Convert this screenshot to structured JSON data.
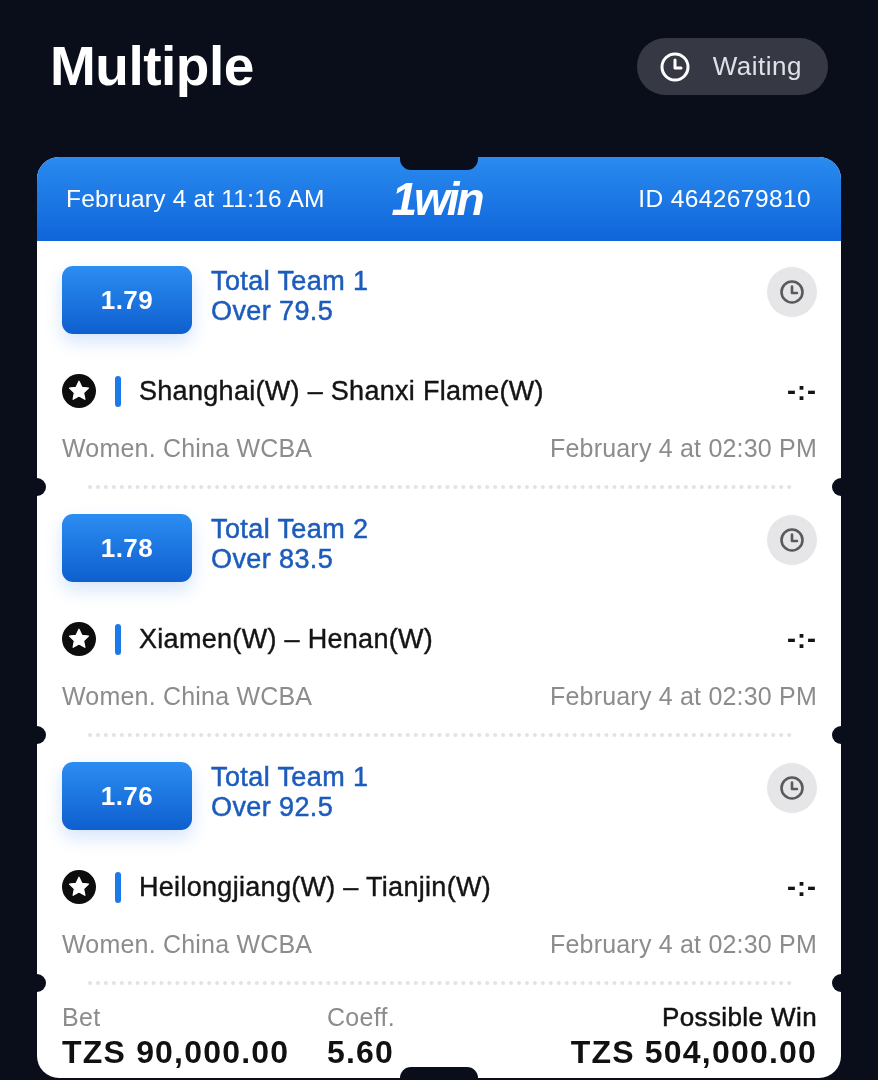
{
  "page": {
    "title": "Multiple",
    "status": {
      "label": "Waiting"
    }
  },
  "ticket": {
    "date": "February 4 at 11:16 AM",
    "logo": "1win",
    "id": "ID 4642679810",
    "bets": [
      {
        "odds": "1.79",
        "market": "Total Team 1",
        "outcome": "Over 79.5",
        "match": "Shanghai(W) – Shanxi Flame(W)",
        "score": "-:-",
        "league": "Women. China WCBA",
        "start": "February 4 at 02:30 PM"
      },
      {
        "odds": "1.78",
        "market": "Total Team 2",
        "outcome": "Over 83.5",
        "match": "Xiamen(W) – Henan(W)",
        "score": "-:-",
        "league": "Women. China WCBA",
        "start": "February 4 at 02:30 PM"
      },
      {
        "odds": "1.76",
        "market": "Total Team 1",
        "outcome": "Over 92.5",
        "match": "Heilongjiang(W) – Tianjin(W)",
        "score": "-:-",
        "league": "Women. China WCBA",
        "start": "February 4 at 02:30 PM"
      }
    ],
    "summary": {
      "bet_label": "Bet",
      "bet": "TZS 90,000.00",
      "coeff_label": "Coeff.",
      "coeff": "5.60",
      "win_label": "Possible Win",
      "win": "TZS 504,000.00"
    }
  }
}
